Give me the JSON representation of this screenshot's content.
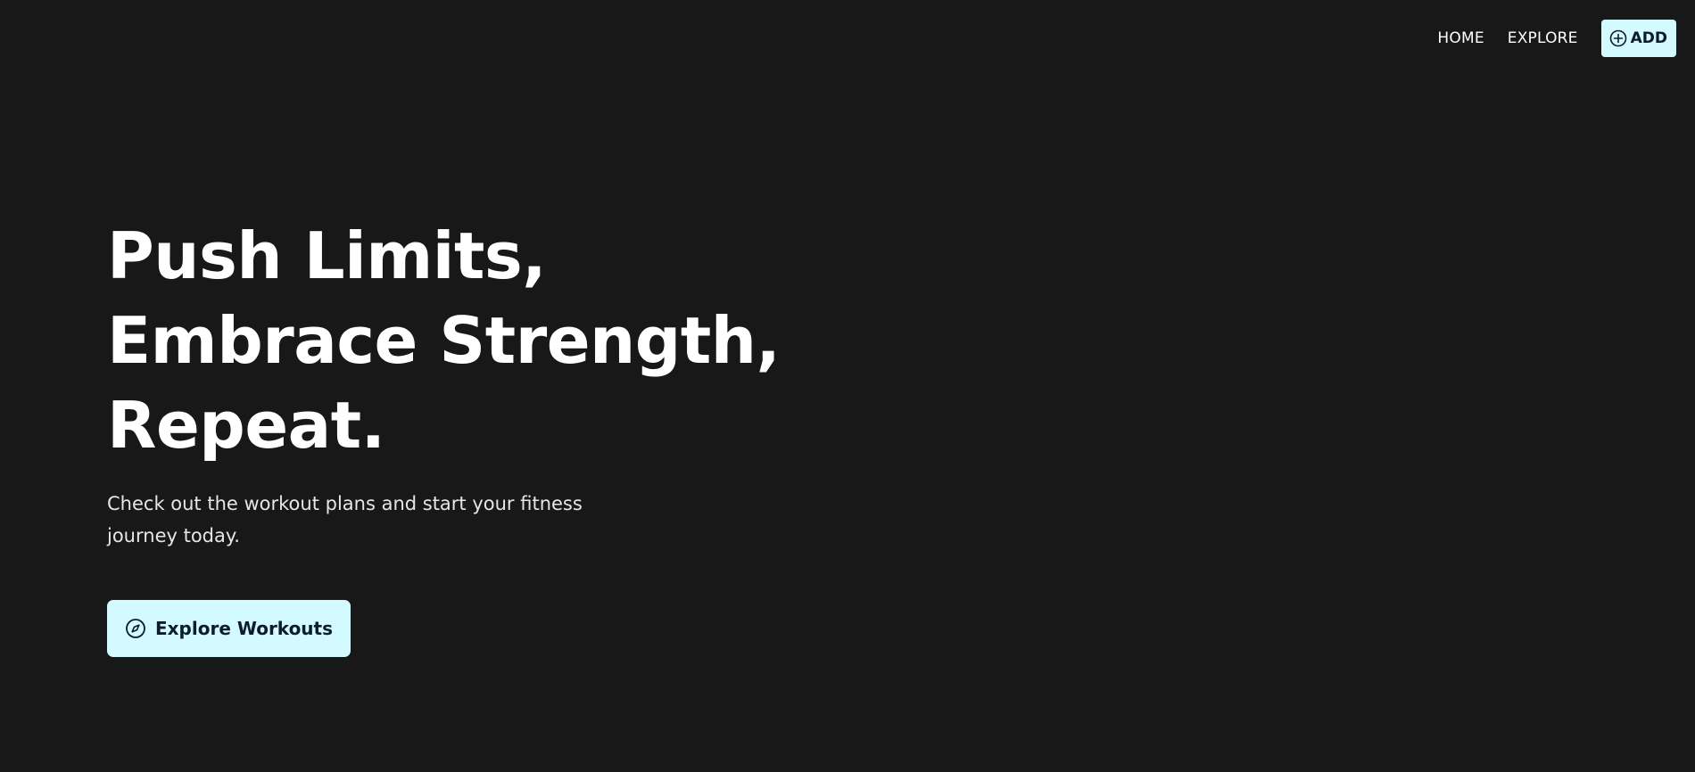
{
  "nav": {
    "home_label": "HOME",
    "explore_label": "EXPLORE",
    "add_label": "ADD",
    "add_icon": "plus-circle-icon"
  },
  "hero": {
    "title_lines": [
      "Push Limits,",
      "Embrace Strength,",
      "Repeat."
    ],
    "subtitle": "Check out the workout plans and start your fitness journey today.",
    "cta_label": "Explore Workouts",
    "cta_icon": "compass-icon"
  },
  "colors": {
    "background": "#181818",
    "accent": "#d3fbff",
    "accent_text": "#0d1b2a",
    "text": "#ffffff"
  }
}
